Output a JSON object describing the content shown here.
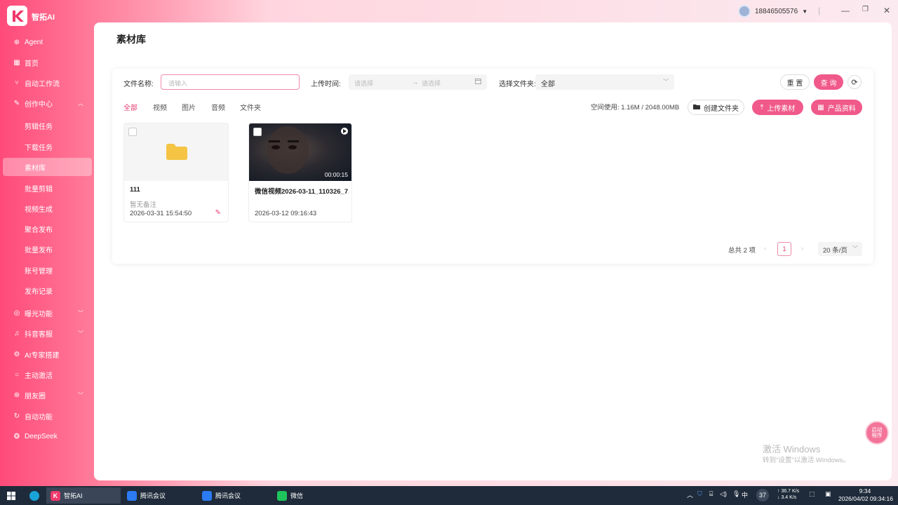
{
  "app": {
    "name": "智拓AI"
  },
  "user": {
    "phone": "18846505576"
  },
  "window_controls": {
    "separator": "|",
    "minimize": "—",
    "restore": "❐",
    "close": "✕"
  },
  "sidebar": {
    "items": [
      {
        "label": "Agent"
      },
      {
        "label": "首页"
      },
      {
        "label": "自动工作流"
      },
      {
        "label": "创作中心"
      },
      {
        "label": "剪辑任务"
      },
      {
        "label": "下载任务"
      },
      {
        "label": "素材库"
      },
      {
        "label": "批量剪辑"
      },
      {
        "label": "视频生成"
      },
      {
        "label": "聚合发布"
      },
      {
        "label": "批量发布"
      },
      {
        "label": "账号管理"
      },
      {
        "label": "发布记录"
      },
      {
        "label": "曝光功能"
      },
      {
        "label": "抖音客服"
      },
      {
        "label": "AI专家搭建"
      },
      {
        "label": "主动激活"
      },
      {
        "label": "朋友圈"
      },
      {
        "label": "自动功能"
      },
      {
        "label": "DeepSeek"
      }
    ]
  },
  "page": {
    "title": "素材库"
  },
  "filters": {
    "name_label": "文件名称:",
    "name_placeholder": "请输入",
    "time_label": "上传时间:",
    "date_start": "请选择",
    "date_arrow": "→",
    "date_end": "请选择",
    "folder_label": "选择文件夹:",
    "folder_value": "全部",
    "reset": "重 置",
    "search": "查 询"
  },
  "tabs": [
    "全部",
    "视频",
    "图片",
    "音频",
    "文件夹"
  ],
  "space": {
    "label": "空间使用:",
    "value": "1.16M / 2048.00MB"
  },
  "actions": {
    "create_folder": "创建文件夹",
    "upload": "上传素材",
    "product": "产品资料"
  },
  "tiles": [
    {
      "name": "111",
      "remark": "暂无备注",
      "date": "2026-03-31 15:54:50"
    },
    {
      "name": "微信视频2026-03-11_110326_7...",
      "duration": "00:00:15",
      "date": "2026-03-12 09:16:43"
    }
  ],
  "pagination": {
    "total": "总共 2 项",
    "current": "1",
    "page_size": "20 条/页",
    "prev": "‹",
    "next": "›"
  },
  "watermark": {
    "line1": "激活 Windows",
    "line2": "转到\"设置\"以激活 Windows。"
  },
  "float_button": {
    "label": "启动\n程序"
  },
  "taskbar": {
    "items": [
      "智拓AI",
      "腾讯会议",
      "腾讯会议",
      "微信"
    ],
    "ime": "中",
    "badge": "37",
    "net_up": "↑ 36.7 K/s",
    "net_down": "↓ 3.4 K/s",
    "time": "9:34",
    "datetime": "2026/04/02 09:34:16"
  },
  "colors": {
    "accent": "#f0598a",
    "sidebar_start": "#ff4a7a",
    "taskbar": "#1f2b3a"
  }
}
